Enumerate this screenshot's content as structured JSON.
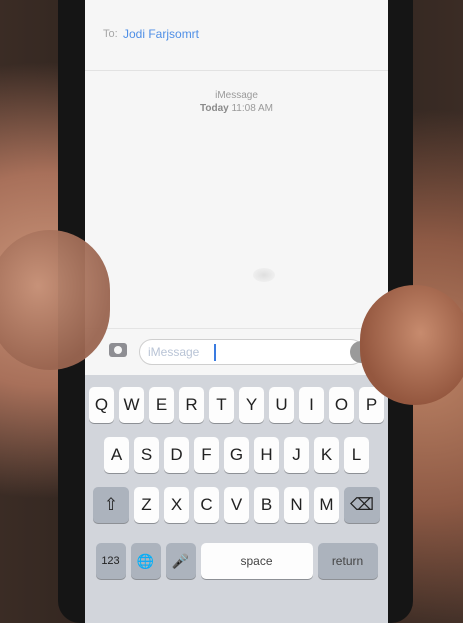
{
  "header": {
    "to_label": "To:",
    "recipient": "Jodi Farjsomrt"
  },
  "conversation": {
    "service_label": "iMessage",
    "time_day": "Today",
    "time_value": "11:08 AM"
  },
  "composer": {
    "placeholder": "iMessage"
  },
  "keyboard": {
    "row1": [
      "Q",
      "W",
      "E",
      "R",
      "T",
      "Y",
      "U",
      "I",
      "O",
      "P"
    ],
    "row2": [
      "A",
      "S",
      "D",
      "F",
      "G",
      "H",
      "J",
      "K",
      "L"
    ],
    "row3": [
      "Z",
      "X",
      "C",
      "V",
      "B",
      "N",
      "M"
    ],
    "numbers_label": "123",
    "space_label": "space",
    "return_label": "return"
  },
  "icons": {
    "camera": "camera-icon",
    "mic": "microphone-icon",
    "shift": "shift-icon",
    "delete": "backspace-icon",
    "globe": "globe-icon",
    "dictation": "dictation-icon"
  }
}
